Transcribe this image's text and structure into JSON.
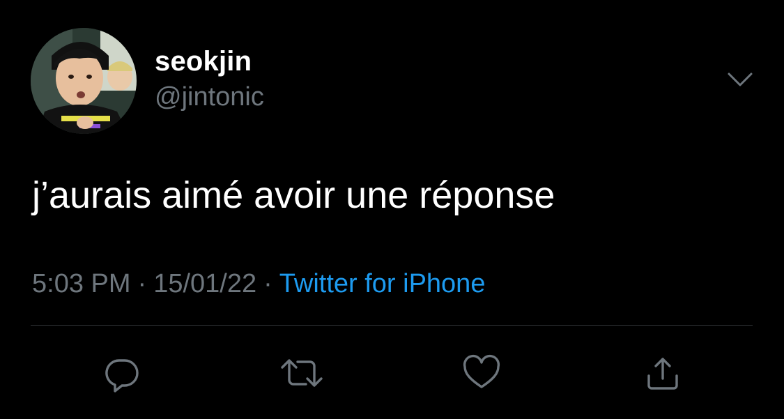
{
  "user": {
    "display_name": "seokjin",
    "handle": "@jintonic",
    "avatar_icon": "profile-photo"
  },
  "tweet": {
    "text": "j’aurais aimé avoir une réponse"
  },
  "meta": {
    "time": "5:03 PM",
    "separator": "·",
    "date": "15/01/22",
    "source": "Twitter for iPhone"
  },
  "colors": {
    "background": "#000000",
    "text_primary": "#ffffff",
    "text_secondary": "#6e767d",
    "accent": "#1d9bf0",
    "divider": "#2f3336"
  },
  "actions": {
    "reply_icon": "reply-icon",
    "retweet_icon": "retweet-icon",
    "like_icon": "heart-icon",
    "share_icon": "share-icon"
  }
}
